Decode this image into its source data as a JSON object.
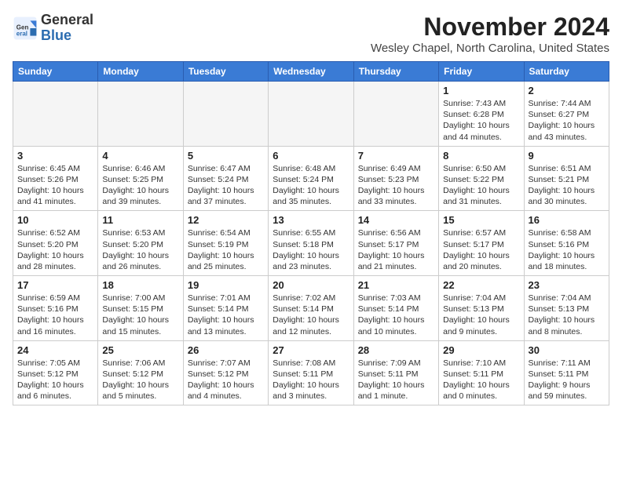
{
  "logo": {
    "general": "General",
    "blue": "Blue"
  },
  "title": "November 2024",
  "subtitle": "Wesley Chapel, North Carolina, United States",
  "days_header": [
    "Sunday",
    "Monday",
    "Tuesday",
    "Wednesday",
    "Thursday",
    "Friday",
    "Saturday"
  ],
  "weeks": [
    [
      {
        "day": "",
        "info": ""
      },
      {
        "day": "",
        "info": ""
      },
      {
        "day": "",
        "info": ""
      },
      {
        "day": "",
        "info": ""
      },
      {
        "day": "",
        "info": ""
      },
      {
        "day": "1",
        "info": "Sunrise: 7:43 AM\nSunset: 6:28 PM\nDaylight: 10 hours and 44 minutes."
      },
      {
        "day": "2",
        "info": "Sunrise: 7:44 AM\nSunset: 6:27 PM\nDaylight: 10 hours and 43 minutes."
      }
    ],
    [
      {
        "day": "3",
        "info": "Sunrise: 6:45 AM\nSunset: 5:26 PM\nDaylight: 10 hours and 41 minutes."
      },
      {
        "day": "4",
        "info": "Sunrise: 6:46 AM\nSunset: 5:25 PM\nDaylight: 10 hours and 39 minutes."
      },
      {
        "day": "5",
        "info": "Sunrise: 6:47 AM\nSunset: 5:24 PM\nDaylight: 10 hours and 37 minutes."
      },
      {
        "day": "6",
        "info": "Sunrise: 6:48 AM\nSunset: 5:24 PM\nDaylight: 10 hours and 35 minutes."
      },
      {
        "day": "7",
        "info": "Sunrise: 6:49 AM\nSunset: 5:23 PM\nDaylight: 10 hours and 33 minutes."
      },
      {
        "day": "8",
        "info": "Sunrise: 6:50 AM\nSunset: 5:22 PM\nDaylight: 10 hours and 31 minutes."
      },
      {
        "day": "9",
        "info": "Sunrise: 6:51 AM\nSunset: 5:21 PM\nDaylight: 10 hours and 30 minutes."
      }
    ],
    [
      {
        "day": "10",
        "info": "Sunrise: 6:52 AM\nSunset: 5:20 PM\nDaylight: 10 hours and 28 minutes."
      },
      {
        "day": "11",
        "info": "Sunrise: 6:53 AM\nSunset: 5:20 PM\nDaylight: 10 hours and 26 minutes."
      },
      {
        "day": "12",
        "info": "Sunrise: 6:54 AM\nSunset: 5:19 PM\nDaylight: 10 hours and 25 minutes."
      },
      {
        "day": "13",
        "info": "Sunrise: 6:55 AM\nSunset: 5:18 PM\nDaylight: 10 hours and 23 minutes."
      },
      {
        "day": "14",
        "info": "Sunrise: 6:56 AM\nSunset: 5:17 PM\nDaylight: 10 hours and 21 minutes."
      },
      {
        "day": "15",
        "info": "Sunrise: 6:57 AM\nSunset: 5:17 PM\nDaylight: 10 hours and 20 minutes."
      },
      {
        "day": "16",
        "info": "Sunrise: 6:58 AM\nSunset: 5:16 PM\nDaylight: 10 hours and 18 minutes."
      }
    ],
    [
      {
        "day": "17",
        "info": "Sunrise: 6:59 AM\nSunset: 5:16 PM\nDaylight: 10 hours and 16 minutes."
      },
      {
        "day": "18",
        "info": "Sunrise: 7:00 AM\nSunset: 5:15 PM\nDaylight: 10 hours and 15 minutes."
      },
      {
        "day": "19",
        "info": "Sunrise: 7:01 AM\nSunset: 5:14 PM\nDaylight: 10 hours and 13 minutes."
      },
      {
        "day": "20",
        "info": "Sunrise: 7:02 AM\nSunset: 5:14 PM\nDaylight: 10 hours and 12 minutes."
      },
      {
        "day": "21",
        "info": "Sunrise: 7:03 AM\nSunset: 5:14 PM\nDaylight: 10 hours and 10 minutes."
      },
      {
        "day": "22",
        "info": "Sunrise: 7:04 AM\nSunset: 5:13 PM\nDaylight: 10 hours and 9 minutes."
      },
      {
        "day": "23",
        "info": "Sunrise: 7:04 AM\nSunset: 5:13 PM\nDaylight: 10 hours and 8 minutes."
      }
    ],
    [
      {
        "day": "24",
        "info": "Sunrise: 7:05 AM\nSunset: 5:12 PM\nDaylight: 10 hours and 6 minutes."
      },
      {
        "day": "25",
        "info": "Sunrise: 7:06 AM\nSunset: 5:12 PM\nDaylight: 10 hours and 5 minutes."
      },
      {
        "day": "26",
        "info": "Sunrise: 7:07 AM\nSunset: 5:12 PM\nDaylight: 10 hours and 4 minutes."
      },
      {
        "day": "27",
        "info": "Sunrise: 7:08 AM\nSunset: 5:11 PM\nDaylight: 10 hours and 3 minutes."
      },
      {
        "day": "28",
        "info": "Sunrise: 7:09 AM\nSunset: 5:11 PM\nDaylight: 10 hours and 1 minute."
      },
      {
        "day": "29",
        "info": "Sunrise: 7:10 AM\nSunset: 5:11 PM\nDaylight: 10 hours and 0 minutes."
      },
      {
        "day": "30",
        "info": "Sunrise: 7:11 AM\nSunset: 5:11 PM\nDaylight: 9 hours and 59 minutes."
      }
    ]
  ]
}
